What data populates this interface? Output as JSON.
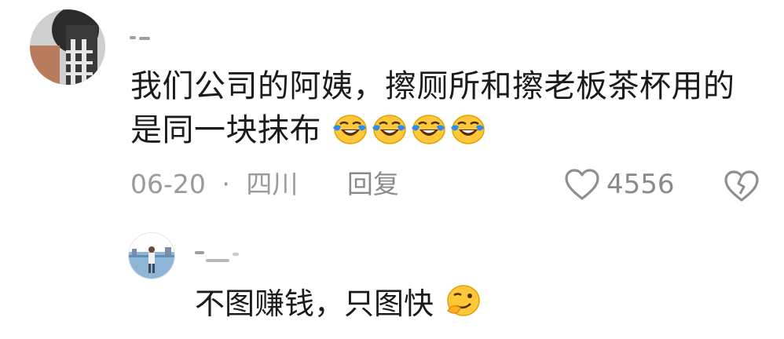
{
  "comment": {
    "text": "我们公司的阿姨，擦厕所和擦老板茶杯用的是同一块抹布",
    "emojis": [
      "laugh-crying-emoji",
      "laugh-crying-emoji",
      "laugh-crying-emoji",
      "laugh-crying-emoji"
    ],
    "date": "06-20",
    "separator": "·",
    "location": "四川",
    "reply_label": "回复",
    "like_count": "4556"
  },
  "reply": {
    "text": "不图赚钱，只图快",
    "emoji": "smirk-thinking-emoji"
  },
  "colors": {
    "text": "#1b1b1b",
    "meta": "#9a9a9a",
    "emoji_yellow": "#ffc83a",
    "emoji_blue": "#2d8cf0"
  }
}
